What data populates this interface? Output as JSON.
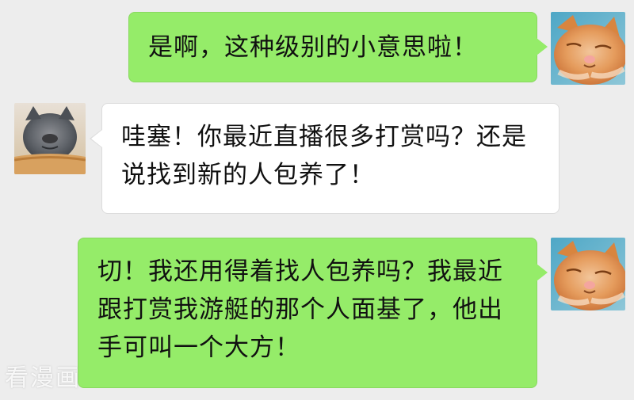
{
  "messages": [
    {
      "side": "right",
      "text": "是啊，这种级别的小意思啦！",
      "avatar": "orange-cat-avatar"
    },
    {
      "side": "left",
      "text": "哇塞！你最近直播很多打赏吗？还是说找到新的人包养了！",
      "avatar": "gray-cat-avatar"
    },
    {
      "side": "right",
      "text": "切！我还用得着找人包养吗？我最近跟打赏我游艇的那个人面基了，他出手可叫一个大方！",
      "avatar": "orange-cat-avatar"
    }
  ],
  "watermark": "看漫画",
  "colors": {
    "background": "#ededed",
    "outgoing_bubble": "#95ec69",
    "incoming_bubble": "#ffffff"
  }
}
